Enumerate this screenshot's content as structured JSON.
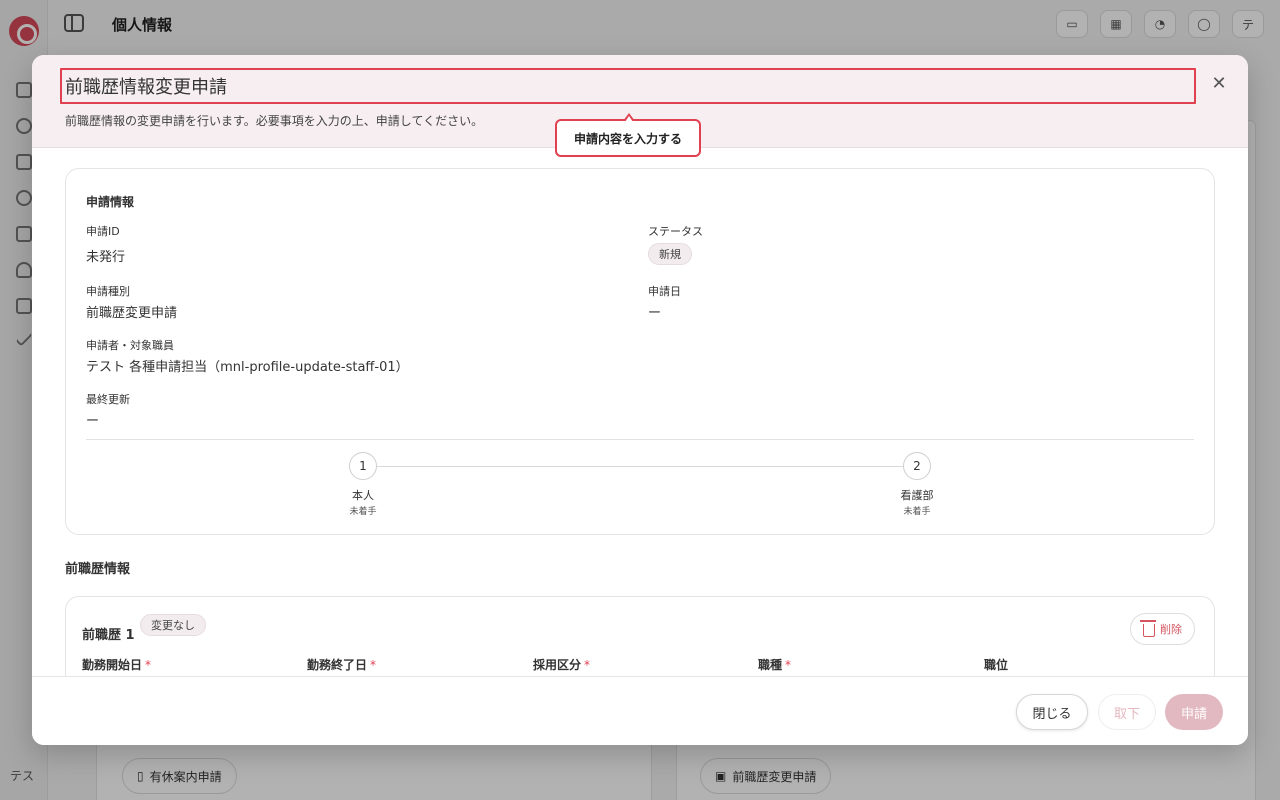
{
  "background": {
    "page_title": "個人情報",
    "user_initials": "テス",
    "buttons": [
      "有休案内申請",
      "前職歴変更申請"
    ],
    "avatar": "テ"
  },
  "modal": {
    "title": "前職歴情報変更申請",
    "description": "前職歴情報の変更申請を行います。必要事項を入力の上、申請してください。",
    "tooltip": "申請内容を入力する",
    "info": {
      "section_title": "申請情報",
      "application_id_label": "申請ID",
      "application_id_value": "未発行",
      "status_label": "ステータス",
      "status_value": "新規",
      "type_label": "申請種別",
      "type_value": "前職歴変更申請",
      "date_label": "申請日",
      "date_value": "ー",
      "applicant_label": "申請者・対象職員",
      "applicant_value": "テスト 各種申請担当（mnl-profile-update-staff-01）",
      "updated_label": "最終更新",
      "updated_value": "ー"
    },
    "steps": [
      {
        "number": "1",
        "name": "本人",
        "status": "未着手"
      },
      {
        "number": "2",
        "name": "看護部",
        "status": "未着手"
      }
    ],
    "prior_section_title": "前職歴情報",
    "job": {
      "title": "前職歴 1",
      "badge": "変更なし",
      "delete_label": "削除",
      "columns": [
        "勤務開始日",
        "勤務終了日",
        "採用区分",
        "職種",
        "職位"
      ]
    },
    "footer": {
      "close_label": "閉じる",
      "withdraw_label": "取下",
      "submit_label": "申請"
    }
  },
  "colors": {
    "accent": "#e0404f",
    "header_bg": "#f6eef1",
    "submit_disabled": "#e2b9c0"
  }
}
